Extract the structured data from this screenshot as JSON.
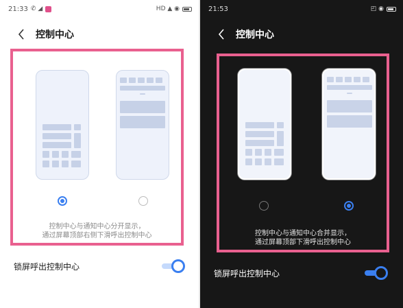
{
  "panels": [
    {
      "theme": "light",
      "status_bar": {
        "time": "21:33",
        "left_icons": "✆ ◢",
        "right_icons": "HD ▲ ◉"
      },
      "header": {
        "title": "控制中心"
      },
      "options": [
        {
          "layout": "separate",
          "selected": true
        },
        {
          "layout": "combined",
          "selected": false
        }
      ],
      "description": [
        "控制中心与通知中心分开显示，",
        "通过屏幕顶部右侧下滑呼出控制中心"
      ],
      "setting": {
        "label": "锁屏呼出控制中心",
        "enabled": true
      }
    },
    {
      "theme": "dark",
      "status_bar": {
        "time": "21:53",
        "left_icons": "",
        "right_icons": "◰ ◉"
      },
      "header": {
        "title": "控制中心"
      },
      "options": [
        {
          "layout": "separate",
          "selected": false
        },
        {
          "layout": "combined",
          "selected": true
        }
      ],
      "description": [
        "控制中心与通知中心合并显示，",
        "通过屏幕顶部下滑呼出控制中心"
      ],
      "setting": {
        "label": "锁屏呼出控制中心",
        "enabled": true
      }
    }
  ],
  "colors": {
    "highlight": "#e9608f",
    "accent": "#3a7ff0"
  },
  "icons": {
    "back": "chevron-left-icon"
  }
}
